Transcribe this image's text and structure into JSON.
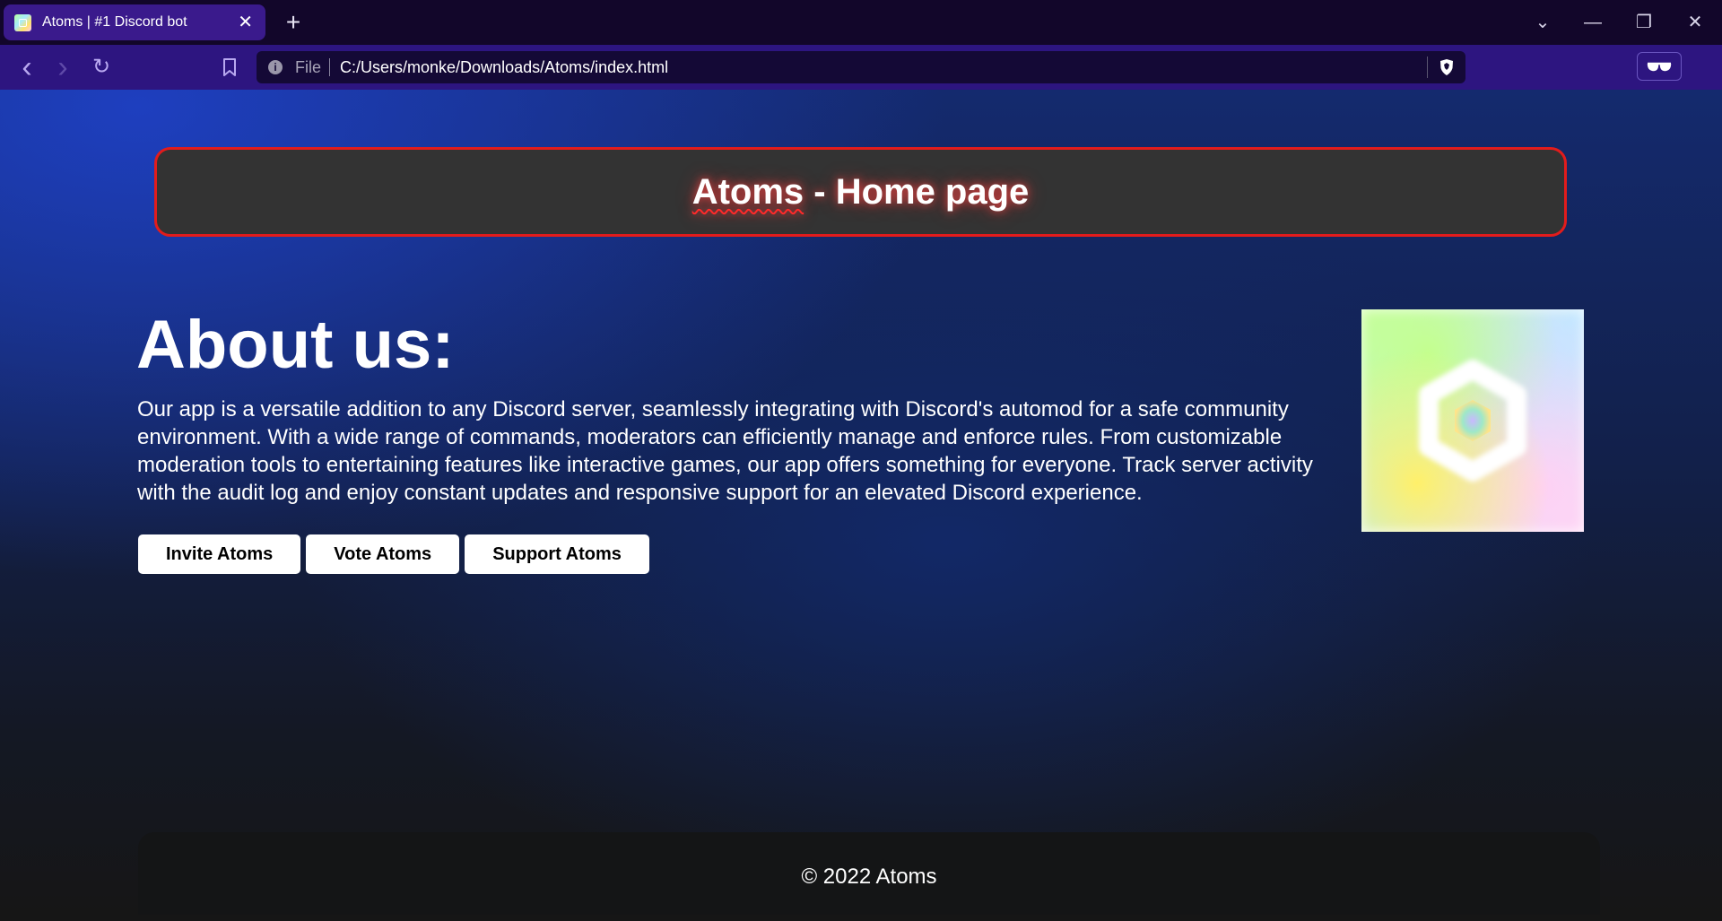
{
  "browser": {
    "tab": {
      "title": "Atoms | #1 Discord bot",
      "close_glyph": "✕"
    },
    "new_tab_glyph": "+",
    "window_controls": {
      "tabs_list_glyph": "⌄",
      "minimize_glyph": "—",
      "restore_glyph": "❐",
      "close_glyph": "✕"
    },
    "nav": {
      "back_glyph": "‹",
      "forward_glyph": "›",
      "reload_glyph": "↻",
      "bookmark_glyph": "🔖",
      "menu_glyph": "≡"
    },
    "address": {
      "info_glyph": "i",
      "scheme": "File",
      "url": "C:/Users/monke/Downloads/Atoms/index.html"
    },
    "colors": {
      "tabbar": "#12062a",
      "active_tab": "#3a1a8c",
      "toolbar": "#2d1580",
      "address_bg": "#140936"
    }
  },
  "page": {
    "header": {
      "title_word": "Atoms",
      "title_rest": " - Home page"
    },
    "about": {
      "heading": "About us:",
      "text": "Our app is a versatile addition to any Discord server, seamlessly integrating with Discord's automod for a safe community environment. With a wide range of commands, moderators can efficiently manage and enforce rules. From customizable moderation tools to entertaining features like interactive games, our app offers something for everyone. Track server activity with the audit log and enjoy constant updates and responsive support for an elevated Discord experience."
    },
    "buttons": {
      "invite": "Invite Atoms",
      "vote": "Vote Atoms",
      "support": "Support Atoms"
    },
    "logo_icon": "atoms-hexagon-logo",
    "footer": {
      "text": "© 2022 Atoms"
    },
    "colors": {
      "header_border": "#e21c1c",
      "header_bg": "#333333",
      "gradient_blue": "#1e3fbf",
      "footer_bg": "#141516"
    }
  }
}
